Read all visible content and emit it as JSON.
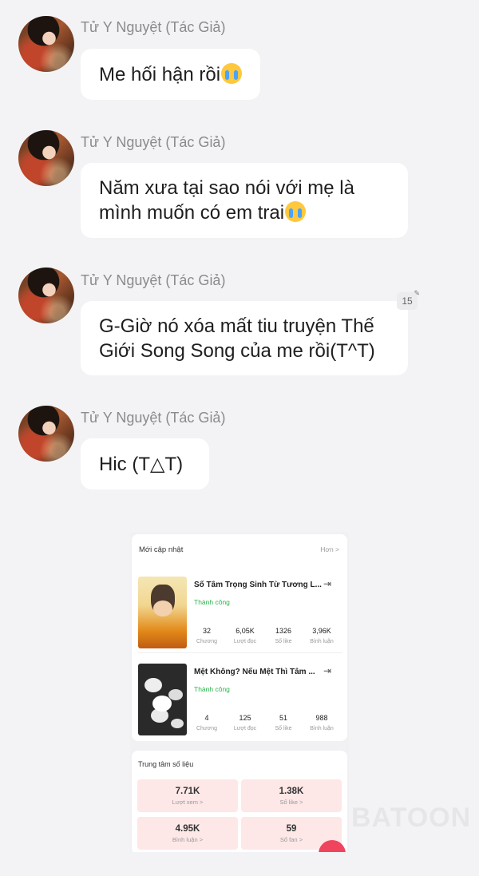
{
  "messages": [
    {
      "author": "Tử Y Nguyệt (Tác Giả)",
      "lines": [
        "Me hối hận rồi"
      ],
      "emoji": "crying-emoji"
    },
    {
      "author": "Tử Y Nguyệt (Tác Giả)",
      "lines": [
        "Năm xưa tại sao nói với mẹ là",
        "mình muốn có em trai"
      ],
      "emoji": "crying-emoji"
    },
    {
      "author": "Tử Y Nguyệt (Tác Giả)",
      "lines": [
        "G-Giờ nó xóa mất tiu truyện Thế",
        "Giới Song Song của me rồi(T^T)"
      ],
      "badge": "15"
    },
    {
      "author": "Tử Y Nguyệt (Tác Giả)",
      "lines": [
        "Hic (T△T)"
      ]
    }
  ],
  "screenshot": {
    "recent": {
      "title": "Mới cập nhật",
      "more": "Hơn >",
      "books": [
        {
          "title": "Sổ Tâm Trọng Sinh Từ Tương L...",
          "status": "Thành công",
          "stats": [
            {
              "value": "32",
              "label": "Chương"
            },
            {
              "value": "6,05K",
              "label": "Lượt đọc"
            },
            {
              "value": "1326",
              "label": "Số like"
            },
            {
              "value": "3,96K",
              "label": "Bình luận"
            }
          ]
        },
        {
          "title": "Mệt Không? Nếu Mệt Thì Tâm ...",
          "status": "Thành công",
          "stats": [
            {
              "value": "4",
              "label": "Chương"
            },
            {
              "value": "125",
              "label": "Lượt đọc"
            },
            {
              "value": "51",
              "label": "Số like"
            },
            {
              "value": "988",
              "label": "Bình luận"
            }
          ]
        }
      ]
    },
    "data_center": {
      "title": "Trung tâm số liệu",
      "tiles": [
        {
          "value": "7.71K",
          "label": "Lượt xem >"
        },
        {
          "value": "1.38K",
          "label": "Số like >"
        },
        {
          "value": "4.95K",
          "label": "Bình luận >"
        },
        {
          "value": "59",
          "label": "Số fan >"
        }
      ]
    }
  },
  "watermark": "BATOON"
}
